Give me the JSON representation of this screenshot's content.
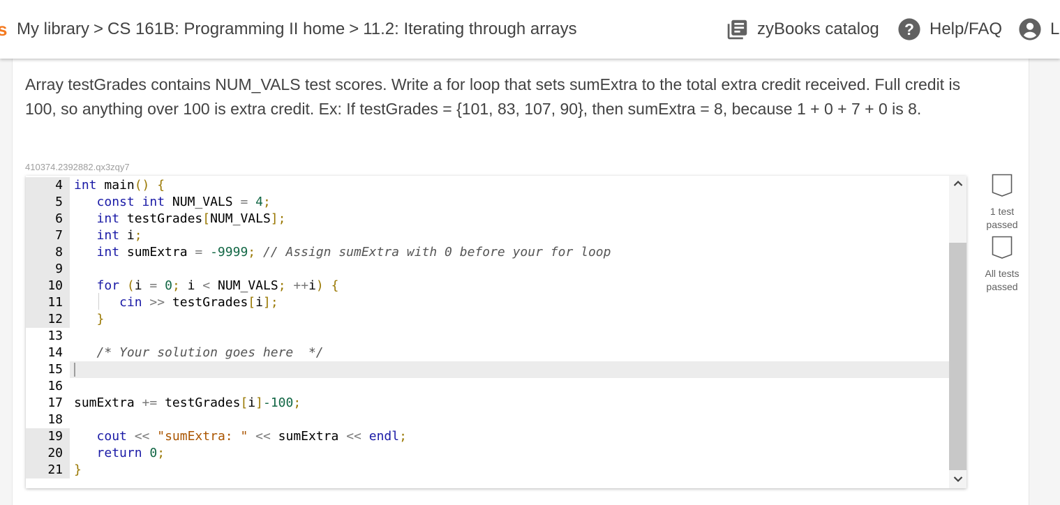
{
  "header": {
    "logo_partial": "s",
    "breadcrumb": [
      "My library",
      "CS 161B: Programming II home",
      "11.2: Iterating through arrays"
    ],
    "separator": ">",
    "catalog_label": "zyBooks catalog",
    "help_label": "Help/FAQ",
    "user_partial": "L"
  },
  "challenge": {
    "prompt": "Array testGrades contains NUM_VALS test scores. Write a for loop that sets sumExtra to the total extra credit received. Full credit is 100, so anything over 100 is extra credit. Ex: If testGrades = {101, 83, 107, 90}, then sumExtra = 8, because 1 + 0 + 7 + 0 is 8.",
    "code_id": "410374.2392882.qx3zqy7"
  },
  "editor": {
    "line_numbers": [
      "4",
      "5",
      "6",
      "7",
      "8",
      "9",
      "10",
      "11",
      "12",
      "13",
      "14",
      "15",
      "16",
      "17",
      "18",
      "19",
      "20",
      "21"
    ],
    "read_only_lines": [
      "4",
      "5",
      "6",
      "7",
      "8",
      "9",
      "10",
      "11",
      "12",
      "19",
      "20",
      "21"
    ],
    "lines": [
      "int main() {",
      "   const int NUM_VALS = 4;",
      "   int testGrades[NUM_VALS];",
      "   int i;",
      "   int sumExtra = -9999; // Assign sumExtra with 0 before your for loop",
      "",
      "   for (i = 0; i < NUM_VALS; ++i) {",
      "      cin >> testGrades[i];",
      "   }",
      "",
      "   /* Your solution goes here  */",
      "",
      "",
      "sumExtra += testGrades[i]-100;",
      "",
      "   cout << \"sumExtra: \" << sumExtra << endl;",
      "   return 0;",
      "}"
    ],
    "active_line": "15"
  },
  "tests": [
    {
      "label_line1": "1 test",
      "label_line2": "passed",
      "passed": false
    },
    {
      "label_line1": "All tests",
      "label_line2": "passed",
      "passed": false
    }
  ],
  "icons": {
    "catalog": "library-book-icon",
    "help": "question-circle-icon",
    "user": "account-circle-icon",
    "scroll_up": "chevron-up-icon",
    "scroll_down": "chevron-down-icon",
    "badge": "test-badge-icon"
  },
  "colors": {
    "brand_orange": "#f47a20",
    "keyword": "#1a1aa6",
    "number": "#116644",
    "punct": "#997700",
    "string": "#aa5500",
    "comment": "#555555"
  }
}
